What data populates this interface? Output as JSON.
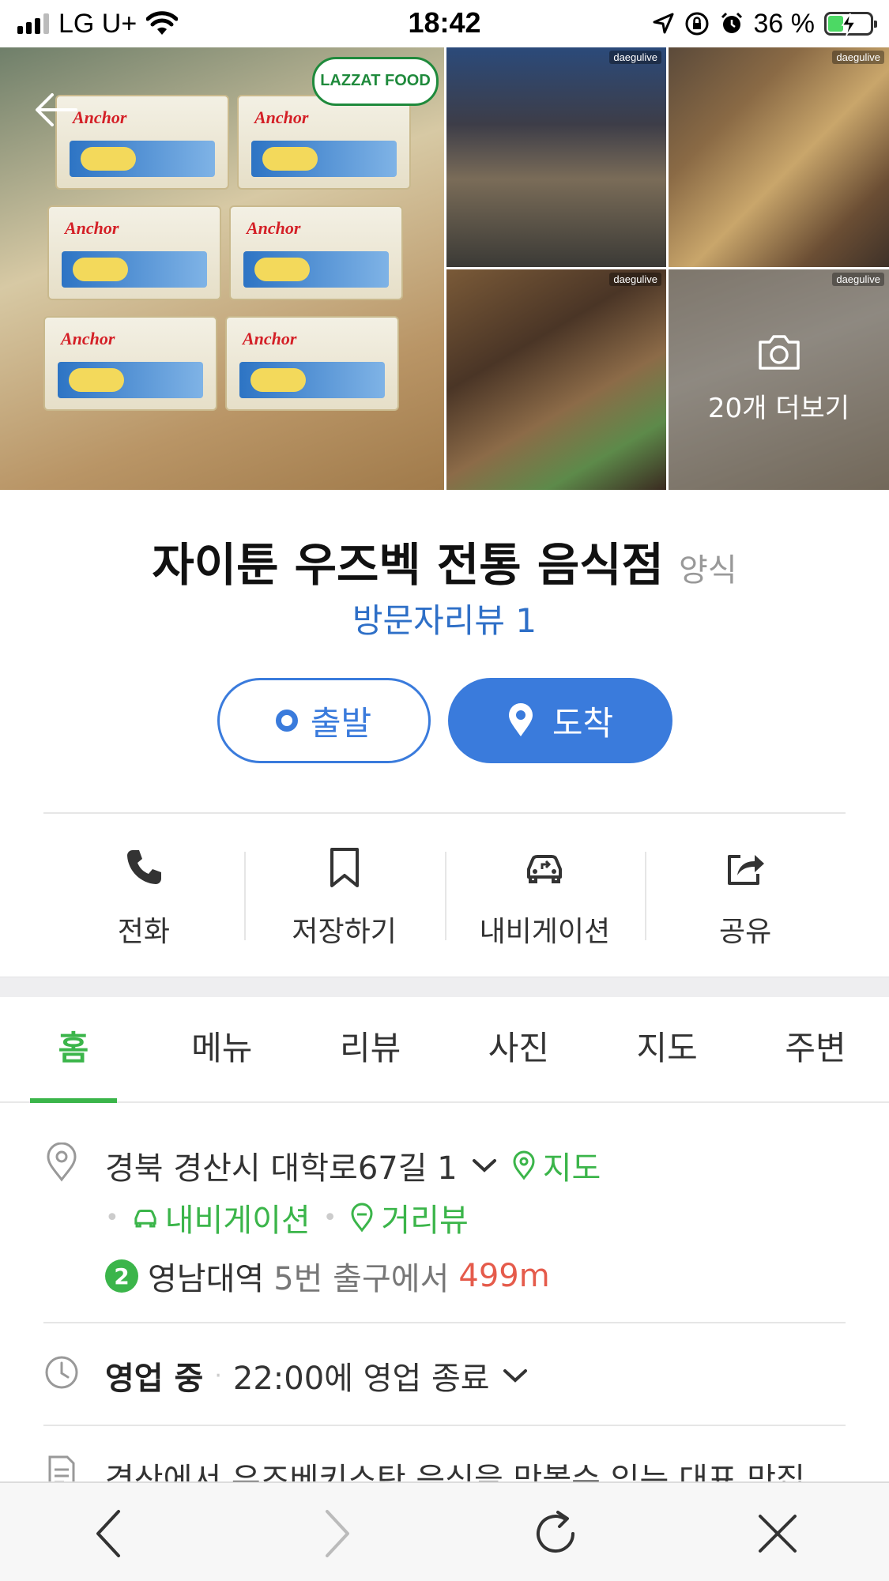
{
  "status_bar": {
    "carrier": "LG U+",
    "time": "18:42",
    "battery_percent": "36 %",
    "battery_level": 0.36,
    "icons": [
      "signal-icon",
      "wifi-icon",
      "location-arrow-icon",
      "orientation-lock-icon",
      "alarm-icon",
      "battery-charging-icon"
    ]
  },
  "photos": {
    "main_logo_text": "LAZZAT FOOD",
    "watermark": "daegulive",
    "more_label": "20개 더보기"
  },
  "place": {
    "name": "자이툰 우즈벡 전통 음식점",
    "category": "양식",
    "review_link": "방문자리뷰 1"
  },
  "directions": {
    "depart_label": "출발",
    "arrive_label": "도착"
  },
  "actions": [
    {
      "label": "전화",
      "icon": "phone-icon"
    },
    {
      "label": "저장하기",
      "icon": "bookmark-icon"
    },
    {
      "label": "내비게이션",
      "icon": "car-navigation-icon"
    },
    {
      "label": "공유",
      "icon": "share-icon"
    }
  ],
  "tabs": [
    {
      "label": "홈",
      "active": true
    },
    {
      "label": "메뉴",
      "active": false
    },
    {
      "label": "리뷰",
      "active": false
    },
    {
      "label": "사진",
      "active": false
    },
    {
      "label": "지도",
      "active": false
    },
    {
      "label": "주변",
      "active": false
    }
  ],
  "address": {
    "text": "경북 경산시 대학로67길 1",
    "map_link": "지도",
    "navigation_link": "내비게이션",
    "streetview_link": "거리뷰"
  },
  "subway": {
    "line_number": "2",
    "station": "영남대역",
    "exit_text": "5번 출구에서",
    "distance": "499m"
  },
  "hours": {
    "status": "영업 중",
    "separator": "·",
    "detail": "22:00에 영업 종료"
  },
  "description": {
    "text": "경산에서 우즈베키스탄 음식을 맛볼수 있는 대표 맛집"
  },
  "colors": {
    "primary_blue": "#3a7bdc",
    "green": "#3bb54a",
    "distance_red": "#e55b4b"
  }
}
